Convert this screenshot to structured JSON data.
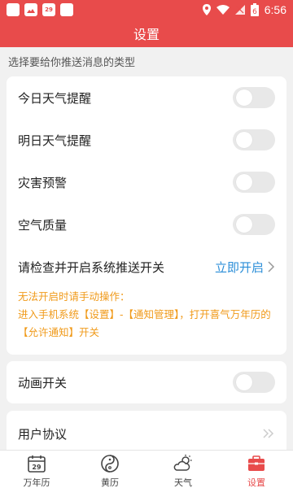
{
  "status_bar": {
    "time": "6:56",
    "calendar_day": "29",
    "battery_level": "6"
  },
  "header": {
    "title": "设置"
  },
  "section_hint": "选择要给你推送消息的类型",
  "push_settings": {
    "items": [
      {
        "label": "今日天气提醒",
        "enabled": false
      },
      {
        "label": "明日天气提醒",
        "enabled": false
      },
      {
        "label": "灾害预警",
        "enabled": false
      },
      {
        "label": "空气质量",
        "enabled": false
      }
    ],
    "system_push": {
      "label": "请检查并开启系统推送开关",
      "action": "立即开启"
    },
    "notice": {
      "line1": "无法开启时请手动操作：",
      "line2": "进入手机系统【设置】-【通知管理】，打开喜气万年历的【允许通知】开关"
    }
  },
  "animation": {
    "label": "动画开关",
    "enabled": false
  },
  "user_agreement": {
    "label": "用户协议"
  },
  "bottom_nav": {
    "items": [
      {
        "label": "万年历",
        "icon": "calendar-icon",
        "icon_text": "29"
      },
      {
        "label": "黄历",
        "icon": "yin-yang-icon"
      },
      {
        "label": "天气",
        "icon": "weather-icon"
      },
      {
        "label": "设置",
        "icon": "toolbox-icon",
        "active": true
      }
    ]
  },
  "colors": {
    "brand_red": "#e84b4b",
    "link_blue": "#2b8ed8",
    "notice_orange": "#f09a1a"
  }
}
